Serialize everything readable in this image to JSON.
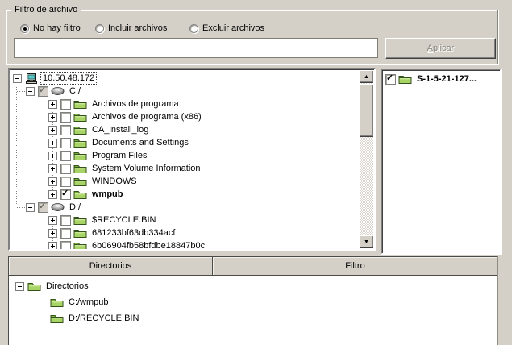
{
  "icons": {
    "check": "✓",
    "up_arrow": "▲",
    "down_arrow": "▼"
  },
  "filter_group": {
    "title": "Filtro de archivo",
    "radios": [
      {
        "label": "No hay filtro",
        "selected": true
      },
      {
        "label": "Incluir archivos",
        "selected": false
      },
      {
        "label": "Excluir archivos",
        "selected": false
      }
    ],
    "filter_input": {
      "value": "",
      "placeholder": ""
    },
    "apply_button": {
      "label": "Aplicar",
      "enabled": false
    }
  },
  "server_tree": {
    "rows": [
      {
        "level": 0,
        "expander": "minus",
        "icon": "computer",
        "checkbox": "none",
        "label": "10.50.48.172",
        "focused": true
      },
      {
        "level": 1,
        "expander": "minus",
        "icon": "drive",
        "checkbox": "partial",
        "label": "C:/"
      },
      {
        "level": 2,
        "expander": "plus",
        "icon": "folder",
        "checkbox": "unchecked",
        "label": "Archivos de programa"
      },
      {
        "level": 2,
        "expander": "plus",
        "icon": "folder",
        "checkbox": "unchecked",
        "label": "Archivos de programa (x86)"
      },
      {
        "level": 2,
        "expander": "plus",
        "icon": "folder",
        "checkbox": "unchecked",
        "label": "CA_install_log"
      },
      {
        "level": 2,
        "expander": "plus",
        "icon": "folder",
        "checkbox": "unchecked",
        "label": "Documents and Settings"
      },
      {
        "level": 2,
        "expander": "plus",
        "icon": "folder",
        "checkbox": "unchecked",
        "label": "Program Files"
      },
      {
        "level": 2,
        "expander": "plus",
        "icon": "folder",
        "checkbox": "unchecked",
        "label": "System Volume Information"
      },
      {
        "level": 2,
        "expander": "plus",
        "icon": "folder",
        "checkbox": "unchecked",
        "label": "WINDOWS"
      },
      {
        "level": 2,
        "expander": "plus",
        "icon": "folder",
        "checkbox": "checked",
        "label": "wmpub",
        "bold": true
      },
      {
        "level": 1,
        "expander": "minus",
        "icon": "drive",
        "checkbox": "partial",
        "label": "D:/"
      },
      {
        "level": 2,
        "expander": "plus",
        "icon": "folder",
        "checkbox": "unchecked",
        "label": "$RECYCLE.BIN"
      },
      {
        "level": 2,
        "expander": "plus",
        "icon": "folder",
        "checkbox": "unchecked",
        "label": "681233bf63db334acf"
      },
      {
        "level": 2,
        "expander": "plus",
        "icon": "folder",
        "checkbox": "unchecked",
        "label": "6b06904fb58bfdbe18847b0c"
      }
    ]
  },
  "selection_list": {
    "items": [
      {
        "checkbox": "checked",
        "icon": "folder",
        "label": "S-1-5-21-127...",
        "bold": true
      }
    ]
  },
  "summary_panel": {
    "columns": [
      "Directorios",
      "Filtro"
    ],
    "rows": [
      {
        "level": 0,
        "expander": "minus",
        "icon": "folder",
        "label": "Directorios"
      },
      {
        "level": 1,
        "icon": "folder",
        "label": "C:/wmpub"
      },
      {
        "level": 1,
        "icon": "folder",
        "label": "D:/RECYCLE.BIN"
      }
    ]
  }
}
